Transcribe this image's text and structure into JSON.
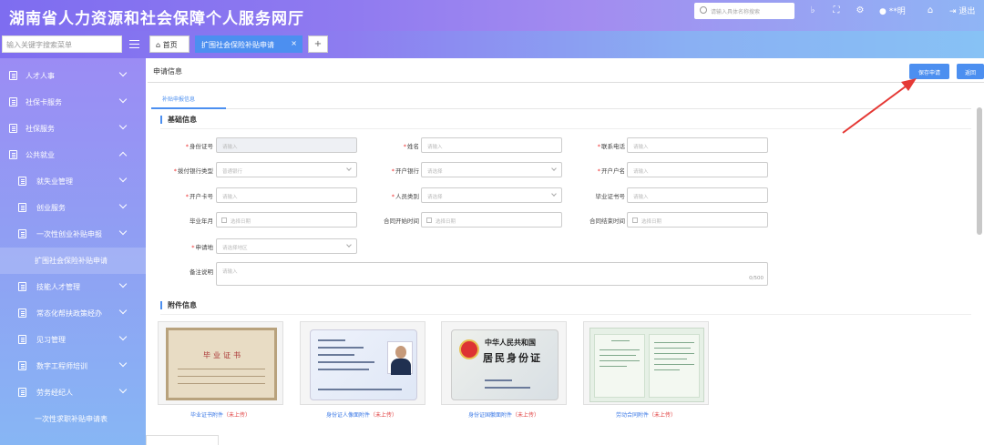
{
  "header": {
    "title": "湖南省人力资源和社会保障个人服务网厅",
    "search_placeholder": "请输入具体名称搜索",
    "icons": [
      "bell-icon",
      "fullscreen-icon",
      "settings-icon",
      "user-icon",
      "lock-icon",
      "logout-icon"
    ],
    "user_name": "**明",
    "logout_label": "退出"
  },
  "tabbar": {
    "menu_search_placeholder": "输入关键字搜索菜单",
    "home_tab": "首页",
    "active_tab": "扩围社会保险补贴申请",
    "add_tab": "+"
  },
  "sidebar": {
    "items": [
      {
        "label": "人才人事",
        "level": 0,
        "expanded": false
      },
      {
        "label": "社保卡服务",
        "level": 0,
        "expanded": false
      },
      {
        "label": "社保服务",
        "level": 0,
        "expanded": false
      },
      {
        "label": "公共就业",
        "level": 0,
        "expanded": true
      },
      {
        "label": "就失业管理",
        "level": 1,
        "expanded": false
      },
      {
        "label": "创业服务",
        "level": 1,
        "expanded": false
      },
      {
        "label": "一次性创业补贴申报",
        "level": 1,
        "expanded": false
      },
      {
        "label": "扩围社会保险补贴申请",
        "level": 2,
        "active": true
      },
      {
        "label": "技能人才管理",
        "level": 1,
        "expanded": false
      },
      {
        "label": "常态化帮扶政策经办",
        "level": 1,
        "expanded": false
      },
      {
        "label": "见习管理",
        "level": 1,
        "expanded": false
      },
      {
        "label": "数字工程师培训",
        "level": 1,
        "expanded": false
      },
      {
        "label": "劳务经纪人",
        "level": 1,
        "expanded": false
      },
      {
        "label": "一次性求职补贴申请表",
        "level": 2
      }
    ]
  },
  "main": {
    "page_title": "申请信息",
    "save_button": "保存申请",
    "back_button": "返回",
    "subtab": "补贴申报信息",
    "basic_section": "基础信息",
    "attach_section": "附件信息",
    "fields": [
      {
        "label": "身份证号",
        "required": true,
        "placeholder": "请输入",
        "type": "text",
        "disabled": true
      },
      {
        "label": "姓名",
        "required": true,
        "placeholder": "请输入",
        "type": "text"
      },
      {
        "label": "联系电话",
        "required": true,
        "placeholder": "请输入",
        "type": "text"
      },
      {
        "label": "拨付银行类型",
        "required": true,
        "placeholder": "普通银行",
        "type": "select"
      },
      {
        "label": "开户银行",
        "required": true,
        "placeholder": "请选择",
        "type": "select"
      },
      {
        "label": "开户户名",
        "required": true,
        "placeholder": "请输入",
        "type": "text"
      },
      {
        "label": "开户卡号",
        "required": true,
        "placeholder": "请输入",
        "type": "text"
      },
      {
        "label": "人员类别",
        "required": true,
        "placeholder": "请选择",
        "type": "select"
      },
      {
        "label": "毕业证书号",
        "required": false,
        "placeholder": "请输入",
        "type": "text"
      },
      {
        "label": "毕业年月",
        "required": false,
        "placeholder": "选择日期",
        "type": "date"
      },
      {
        "label": "合同开始时间",
        "required": false,
        "placeholder": "选择日期",
        "type": "date"
      },
      {
        "label": "合同结束时间",
        "required": false,
        "placeholder": "选择日期",
        "type": "date"
      },
      {
        "label": "申请地",
        "required": true,
        "placeholder": "请选择地区",
        "type": "select"
      }
    ],
    "remarks": {
      "label": "备注说明",
      "placeholder": "请输入",
      "counter": "0/500"
    },
    "attachments": [
      {
        "name": "毕业证书附件",
        "status": "（未上传）",
        "icon": "diploma-image"
      },
      {
        "name": "身份证人像面附件",
        "status": "（未上传）",
        "icon": "id-card-front-image"
      },
      {
        "name": "身份证国徽面附件",
        "status": "（未上传）",
        "icon": "id-card-back-image"
      },
      {
        "name": "劳动合同附件",
        "status": "（未上传）",
        "icon": "labor-contract-image"
      }
    ],
    "thumb_text": {
      "diploma_heading": "毕业证书",
      "id_back_line1": "中华人民共和国",
      "id_back_line2": "居民身份证"
    }
  },
  "colors": {
    "header_gradient_start": "#7e6df0",
    "header_gradient_end": "#8fb5f5",
    "accent_blue": "#4c8ff0",
    "required_red": "#e33333",
    "annotation_arrow": "#e53935"
  }
}
